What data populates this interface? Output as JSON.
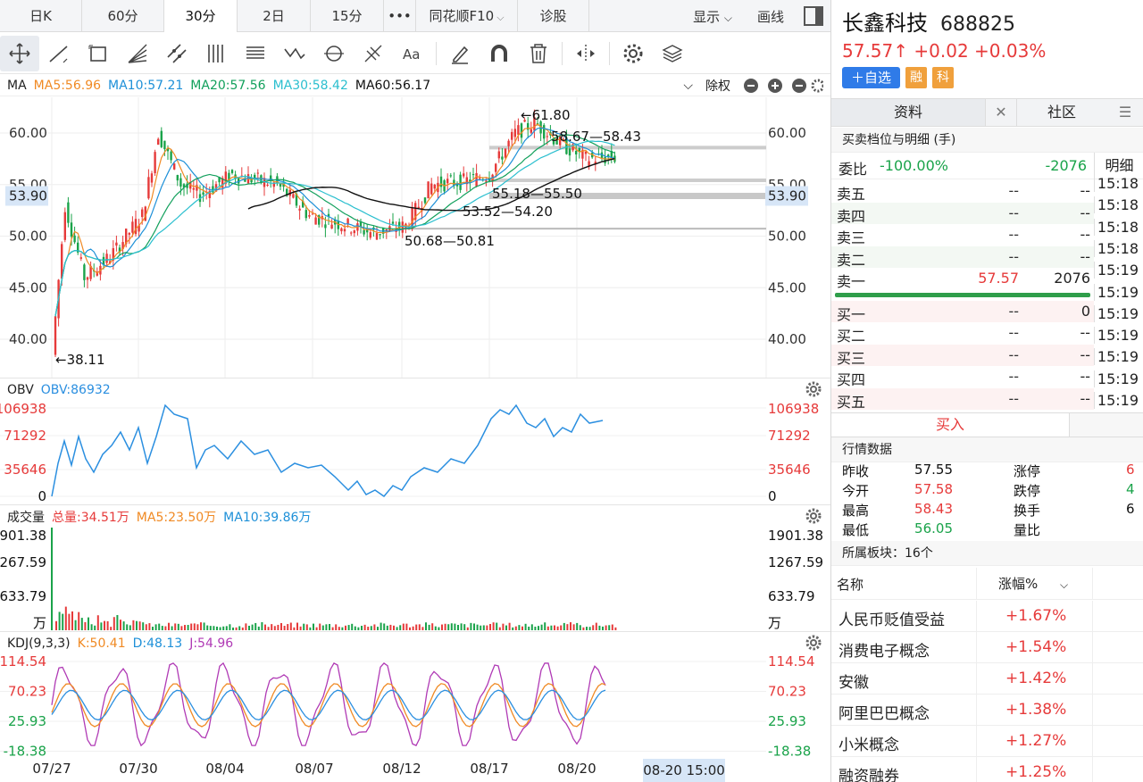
{
  "tabs": [
    {
      "label": "日K",
      "active": false
    },
    {
      "label": "60分",
      "active": false
    },
    {
      "label": "30分",
      "active": true
    },
    {
      "label": "2日",
      "active": false
    },
    {
      "label": "15分",
      "active": false
    },
    {
      "label": "•••",
      "active": false
    },
    {
      "label": "同花顺F10",
      "active": false
    },
    {
      "label": "诊股",
      "active": false
    }
  ],
  "tab_right": {
    "display": "显示",
    "draw": "画线"
  },
  "ma_bar": {
    "label": "MA",
    "ma5": "MA5:56.96",
    "ma10": "MA10:57.21",
    "ma20": "MA20:57.56",
    "ma30": "MA30:58.42",
    "ma60": "MA60:56.17",
    "adjust": "除权"
  },
  "colors": {
    "up": "#e63a3a",
    "down": "#1aa34a",
    "ma5": "#f08a24",
    "ma10": "#1e90d8",
    "ma20": "#12a05c",
    "ma30": "#2bbfcf",
    "ma60": "#111111",
    "obv": "#2b8fe0",
    "kdj_j": "#b03ab5",
    "blue": "#2b8fe0",
    "red": "#e63a3a",
    "green": "#1aa34a"
  },
  "price_axis": {
    "ticks": [
      "60.00",
      "55.00",
      "50.00",
      "45.00",
      "40.00"
    ],
    "highlight": "53.90"
  },
  "annotations": {
    "high": "61.80",
    "low": "38.11",
    "zone1": "58.67—58.43",
    "zone2": "55.18—55.50",
    "zone3": "53.52—54.20",
    "zone4": "50.68—50.81"
  },
  "obv": {
    "label": "OBV",
    "value": "OBV:86932",
    "ticks": [
      "106938",
      "71292",
      "35646",
      "0"
    ]
  },
  "volume": {
    "label": "成交量",
    "total": "总量:34.51万",
    "ma5": "MA5:23.50万",
    "ma10": "MA10:39.86万",
    "ticks": [
      "1901.38",
      "1267.59",
      "633.79",
      "万"
    ]
  },
  "kdj": {
    "label": "KDJ(9,3,3)",
    "k": "K:50.41",
    "d": "D:48.13",
    "j": "J:54.96",
    "ticks": [
      "114.54",
      "70.23",
      "25.93",
      "-18.38"
    ]
  },
  "dates": [
    "07/27",
    "07/30",
    "08/04",
    "08/07",
    "08/12",
    "08/17",
    "08/20"
  ],
  "cursor_time": "08-20 15:00",
  "stock": {
    "name": "长鑫科技",
    "code": "688825",
    "price": "57.57",
    "change": "+0.02",
    "pct": "+0.03%",
    "arrow": "↑",
    "add": "＋自选",
    "tag1": "融",
    "tag2": "科"
  },
  "subtabs": {
    "t1": "资料",
    "t2": "社区"
  },
  "orderbook": {
    "title": "买卖档位与明细 (手)",
    "weibi_label": "委比",
    "weibi_pct": "-100.00%",
    "weibi_val": "-2076",
    "detail": "明细",
    "sell": [
      {
        "name": "卖五",
        "price": "--",
        "vol": "--"
      },
      {
        "name": "卖四",
        "price": "--",
        "vol": "--"
      },
      {
        "name": "卖三",
        "price": "--",
        "vol": "--"
      },
      {
        "name": "卖二",
        "price": "--",
        "vol": "--"
      },
      {
        "name": "卖一",
        "price": "57.57",
        "vol": "2076"
      }
    ],
    "buy": [
      {
        "name": "买一",
        "price": "--",
        "vol": "0"
      },
      {
        "name": "买二",
        "price": "--",
        "vol": "--"
      },
      {
        "name": "买三",
        "price": "--",
        "vol": "--"
      },
      {
        "name": "买四",
        "price": "--",
        "vol": "--"
      },
      {
        "name": "买五",
        "price": "--",
        "vol": "--"
      }
    ],
    "times": [
      "15:18",
      "15:18",
      "15:18",
      "15:18",
      "15:19",
      "15:19",
      "15:19",
      "15:19",
      "15:19",
      "15:19",
      "15:19"
    ],
    "buy_btn": "买入"
  },
  "market": {
    "title": "行情数据",
    "rows": [
      {
        "k1": "昨收",
        "v1": "57.55",
        "k2": "涨停",
        "v2": "6"
      },
      {
        "k1": "今开",
        "v1": "57.58",
        "k2": "跌停",
        "v2": "4"
      },
      {
        "k1": "最高",
        "v1": "58.43",
        "k2": "换手",
        "v2": "6"
      },
      {
        "k1": "最低",
        "v1": "56.05",
        "k2": "量比",
        "v2": ""
      }
    ]
  },
  "sectors": {
    "title": "所属板块：16个",
    "col_name": "名称",
    "col_pct": "涨幅%",
    "items": [
      {
        "name": "人民币贬值受益",
        "pct": "+1.67%"
      },
      {
        "name": "消费电子概念",
        "pct": "+1.54%"
      },
      {
        "name": "安徽",
        "pct": "+1.42%"
      },
      {
        "name": "阿里巴巴概念",
        "pct": "+1.38%"
      },
      {
        "name": "小米概念",
        "pct": "+1.27%"
      },
      {
        "name": "融资融券",
        "pct": "+1.25%"
      }
    ]
  }
}
